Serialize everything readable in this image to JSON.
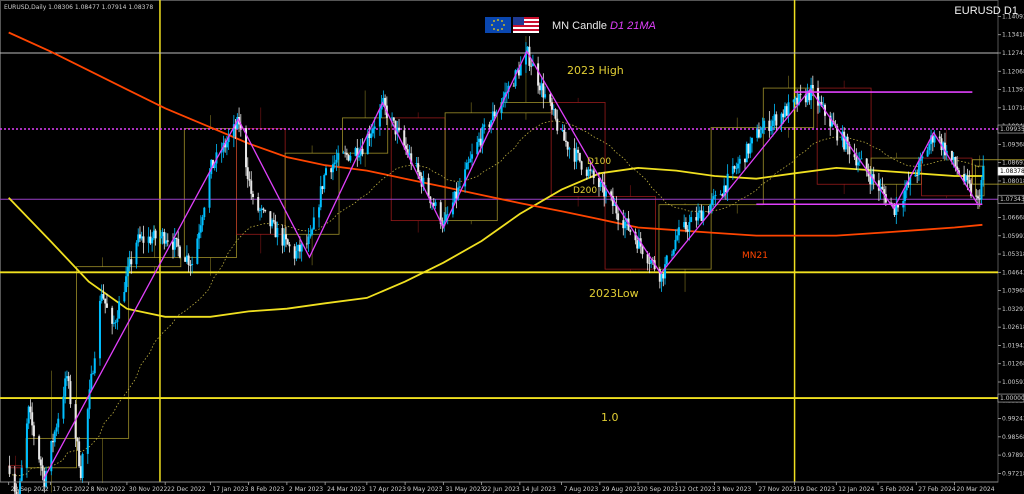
{
  "header": {
    "info": "EURUSD,Daily  1.08306 1.08477 1.07914 1.08378",
    "symbol": "EURUSD D1",
    "caption_main": "MN Candle",
    "caption_ma": "D1 21MA",
    "flag_left": "eu-flag-icon",
    "flag_right": "us-flag-icon"
  },
  "annotations": {
    "high_2023": "2023 High",
    "low_2023": "2023Low",
    "level_1": "1.0",
    "d100": "D100",
    "d200": "D200",
    "mn21": "MN21"
  },
  "colors": {
    "background": "#000000",
    "bull": "#00bfff",
    "bear": "#e8e8e8",
    "zigzag": "#e040fb",
    "d200": "#f0e020",
    "mn21": "#ff4500",
    "level": "#f0e020",
    "magenta_level": "#e040fb",
    "mn_box_up": "#b8a830",
    "mn_box_down": "#b02020"
  },
  "chart_data": {
    "type": "candlestick",
    "symbol": "EURUSD",
    "timeframe": "D1",
    "last_price": 1.08378,
    "ylim": [
      0.969,
      1.147
    ],
    "y_ticks": [
      "1.14768",
      "1.14093",
      "1.13418",
      "1.12743",
      "1.12068",
      "1.11393",
      "1.10718",
      "1.10043",
      "1.09368",
      "1.08693",
      "1.08018",
      "1.07343",
      "1.06668",
      "1.05993",
      "1.05318",
      "1.04643",
      "1.03968",
      "1.03293",
      "1.02618",
      "1.01943",
      "1.01268",
      "1.00593",
      "0.99918",
      "0.99243",
      "0.98568",
      "0.97893",
      "0.97218"
    ],
    "x_ticks": [
      "23 Sep 2022",
      "17 Oct 2022",
      "8 Nov 2022",
      "30 Nov 2022",
      "22 Dec 2022",
      "17 Jan 2023",
      "8 Feb 2023",
      "2 Mar 2023",
      "24 Mar 2023",
      "17 Apr 2023",
      "9 May 2023",
      "31 May 2023",
      "22 Jun 2023",
      "14 Jul 2023",
      "7 Aug 2023",
      "29 Aug 2023",
      "20 Sep 2023",
      "12 Oct 2023",
      "3 Nov 2023",
      "27 Nov 2023",
      "19 Dec 2023",
      "12 Jan 2024",
      "5 Feb 2024",
      "27 Feb 2024",
      "20 Mar 2024"
    ],
    "price_path": [
      {
        "x": "23 Sep 2022",
        "y": 0.975
      },
      {
        "x": "28 Sep 2022",
        "y": 0.962
      },
      {
        "x": "4 Oct 2022",
        "y": 0.995
      },
      {
        "x": "13 Oct 2022",
        "y": 0.97
      },
      {
        "x": "26 Oct 2022",
        "y": 1.008
      },
      {
        "x": "3 Nov 2022",
        "y": 0.973
      },
      {
        "x": "15 Nov 2022",
        "y": 1.04
      },
      {
        "x": "21 Nov 2022",
        "y": 1.025
      },
      {
        "x": "5 Dec 2022",
        "y": 1.058
      },
      {
        "x": "22 Dec 2022",
        "y": 1.06
      },
      {
        "x": "6 Jan 2023",
        "y": 1.05
      },
      {
        "x": "17 Jan 2023",
        "y": 1.085
      },
      {
        "x": "2 Feb 2023",
        "y": 1.102
      },
      {
        "x": "10 Feb 2023",
        "y": 1.072
      },
      {
        "x": "6 Mar 2023",
        "y": 1.053
      },
      {
        "x": "15 Mar 2023",
        "y": 1.058
      },
      {
        "x": "24 Mar 2023",
        "y": 1.085
      },
      {
        "x": "14 Apr 2023",
        "y": 1.093
      },
      {
        "x": "26 Apr 2023",
        "y": 1.108
      },
      {
        "x": "31 May 2023",
        "y": 1.064
      },
      {
        "x": "20 Jun 2023",
        "y": 1.095
      },
      {
        "x": "18 Jul 2023",
        "y": 1.127
      },
      {
        "x": "7 Aug 2023",
        "y": 1.096
      },
      {
        "x": "31 Aug 2023",
        "y": 1.076
      },
      {
        "x": "3 Oct 2023",
        "y": 1.045
      },
      {
        "x": "12 Oct 2023",
        "y": 1.06
      },
      {
        "x": "3 Nov 2023",
        "y": 1.073
      },
      {
        "x": "29 Nov 2023",
        "y": 1.099
      },
      {
        "x": "28 Dec 2023",
        "y": 1.113
      },
      {
        "x": "12 Jan 2024",
        "y": 1.098
      },
      {
        "x": "14 Feb 2024",
        "y": 1.07
      },
      {
        "x": "27 Feb 2024",
        "y": 1.084
      },
      {
        "x": "8 Mar 2024",
        "y": 1.098
      },
      {
        "x": "2 Apr 2024",
        "y": 1.072
      },
      {
        "x": "5 Apr 2024",
        "y": 1.0838
      }
    ],
    "zigzag": [
      {
        "x": "13 Oct 2022",
        "y": 0.97
      },
      {
        "x": "2 Feb 2023",
        "y": 1.103
      },
      {
        "x": "15 Mar 2023",
        "y": 1.052
      },
      {
        "x": "26 Apr 2023",
        "y": 1.109
      },
      {
        "x": "31 May 2023",
        "y": 1.063
      },
      {
        "x": "18 Jul 2023",
        "y": 1.128
      },
      {
        "x": "31 Aug 2023",
        "y": 1.079
      },
      {
        "x": "3 Oct 2023",
        "y": 1.046
      },
      {
        "x": "28 Dec 2023",
        "y": 1.114
      },
      {
        "x": "14 Feb 2024",
        "y": 1.07
      },
      {
        "x": "8 Mar 2024",
        "y": 1.098
      },
      {
        "x": "2 Apr 2024",
        "y": 1.072
      }
    ],
    "series": [
      {
        "name": "D200",
        "points": [
          {
            "x": "23 Sep 2022",
            "y": 1.074
          },
          {
            "x": "17 Oct 2022",
            "y": 1.058
          },
          {
            "x": "8 Nov 2022",
            "y": 1.043
          },
          {
            "x": "30 Nov 2022",
            "y": 1.033
          },
          {
            "x": "22 Dec 2022",
            "y": 1.03
          },
          {
            "x": "17 Jan 2023",
            "y": 1.03
          },
          {
            "x": "8 Feb 2023",
            "y": 1.032
          },
          {
            "x": "2 Mar 2023",
            "y": 1.033
          },
          {
            "x": "24 Mar 2023",
            "y": 1.035
          },
          {
            "x": "17 Apr 2023",
            "y": 1.037
          },
          {
            "x": "9 May 2023",
            "y": 1.043
          },
          {
            "x": "31 May 2023",
            "y": 1.05
          },
          {
            "x": "22 Jun 2023",
            "y": 1.058
          },
          {
            "x": "14 Jul 2023",
            "y": 1.068
          },
          {
            "x": "7 Aug 2023",
            "y": 1.077
          },
          {
            "x": "29 Aug 2023",
            "y": 1.083
          },
          {
            "x": "20 Sep 2023",
            "y": 1.085
          },
          {
            "x": "12 Oct 2023",
            "y": 1.084
          },
          {
            "x": "3 Nov 2023",
            "y": 1.082
          },
          {
            "x": "27 Nov 2023",
            "y": 1.081
          },
          {
            "x": "19 Dec 2023",
            "y": 1.083
          },
          {
            "x": "12 Jan 2024",
            "y": 1.085
          },
          {
            "x": "5 Feb 2024",
            "y": 1.084
          },
          {
            "x": "27 Feb 2024",
            "y": 1.083
          },
          {
            "x": "20 Mar 2024",
            "y": 1.082
          },
          {
            "x": "5 Apr 2024",
            "y": 1.082
          }
        ]
      },
      {
        "name": "MN21",
        "points": [
          {
            "x": "23 Sep 2022",
            "y": 1.135
          },
          {
            "x": "17 Oct 2022",
            "y": 1.128
          },
          {
            "x": "8 Nov 2022",
            "y": 1.121
          },
          {
            "x": "30 Nov 2022",
            "y": 1.114
          },
          {
            "x": "22 Dec 2022",
            "y": 1.107
          },
          {
            "x": "17 Jan 2023",
            "y": 1.1
          },
          {
            "x": "8 Feb 2023",
            "y": 1.094
          },
          {
            "x": "2 Mar 2023",
            "y": 1.089
          },
          {
            "x": "24 Mar 2023",
            "y": 1.086
          },
          {
            "x": "17 Apr 2023",
            "y": 1.084
          },
          {
            "x": "9 May 2023",
            "y": 1.081
          },
          {
            "x": "31 May 2023",
            "y": 1.078
          },
          {
            "x": "22 Jun 2023",
            "y": 1.075
          },
          {
            "x": "14 Jul 2023",
            "y": 1.072
          },
          {
            "x": "7 Aug 2023",
            "y": 1.069
          },
          {
            "x": "29 Aug 2023",
            "y": 1.066
          },
          {
            "x": "20 Sep 2023",
            "y": 1.063
          },
          {
            "x": "12 Oct 2023",
            "y": 1.062
          },
          {
            "x": "3 Nov 2023",
            "y": 1.061
          },
          {
            "x": "27 Nov 2023",
            "y": 1.06
          },
          {
            "x": "19 Dec 2023",
            "y": 1.06
          },
          {
            "x": "12 Jan 2024",
            "y": 1.06
          },
          {
            "x": "5 Feb 2024",
            "y": 1.061
          },
          {
            "x": "27 Feb 2024",
            "y": 1.062
          },
          {
            "x": "20 Mar 2024",
            "y": 1.063
          },
          {
            "x": "5 Apr 2024",
            "y": 1.064
          }
        ]
      }
    ],
    "horizontal_levels": [
      {
        "price": 1.12743,
        "color": "#bbbbbb",
        "style": "solid"
      },
      {
        "price": 1.09935,
        "color": "#e040fb",
        "style": "dotted"
      },
      {
        "price": 1.07343,
        "color": "#9a40c8",
        "style": "solid"
      },
      {
        "price": 1.04643,
        "color": "#f0e020",
        "style": "solid"
      },
      {
        "price": 1.0,
        "color": "#f0e020",
        "style": "solid"
      }
    ],
    "vertical_lines": [
      "19 Dec 2022",
      "19 Dec 2023"
    ],
    "hbox_top": 1.113,
    "hbox_bottom": 1.076,
    "price_labels": [
      "1.09935",
      "1.08378",
      "1.07343",
      "1.00000"
    ]
  }
}
